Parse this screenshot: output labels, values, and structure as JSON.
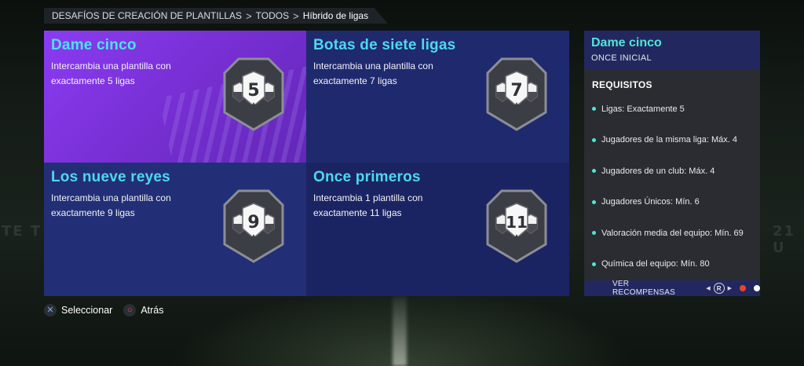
{
  "breadcrumb": {
    "items": [
      "DESAFÍOS DE CREACIÓN DE PLANTILLAS",
      "TODOS",
      "Híbrido de ligas"
    ],
    "separator": ">"
  },
  "tiles": [
    {
      "title": "Dame cinco",
      "desc_line1": "Intercambia una plantilla con",
      "desc_line2": "exactamente 5 ligas",
      "badge_number": "5",
      "selected": true
    },
    {
      "title": "Botas de siete ligas",
      "desc_line1": "Intercambia una plantilla con",
      "desc_line2": "exactamente 7 ligas",
      "badge_number": "7",
      "selected": false
    },
    {
      "title": "Los nueve reyes",
      "desc_line1": "Intercambia una plantilla con",
      "desc_line2": "exactamente 9 ligas",
      "badge_number": "9",
      "selected": false
    },
    {
      "title": "Once primeros",
      "desc_line1": "Intercambia 1 plantilla con",
      "desc_line2": "exactamente 11 ligas",
      "badge_number": "11",
      "selected": false
    }
  ],
  "panel": {
    "title": "Dame cinco",
    "subtitle": "ONCE INICIAL",
    "requirements_header": "REQUISITOS",
    "requirements": [
      "Ligas: Exactamente 5",
      "Jugadores de la misma liga: Máx. 4",
      "Jugadores de un club: Máx. 4",
      "Jugadores Únicos: Mín. 6",
      "Valoración media del equipo: Mín. 69",
      "Química del equipo: Mín. 80"
    ],
    "rewards_label": "VER RECOMPENSAS",
    "pager_button": "R",
    "pager_dots": [
      "#e8452c",
      "#ffffff"
    ]
  },
  "controls": {
    "select": {
      "icon": "✕",
      "label": "Seleccionar"
    },
    "back": {
      "icon": "○",
      "label": "Atrás"
    }
  },
  "colors": {
    "accent_cyan": "#4fd7ef",
    "panel_accent": "#4fe6d8",
    "tile_blue": "#1f2a6e",
    "tile_selected": "#8a3cf2",
    "cross_icon": "#7fa8e6",
    "circle_icon": "#ef4b6a"
  }
}
